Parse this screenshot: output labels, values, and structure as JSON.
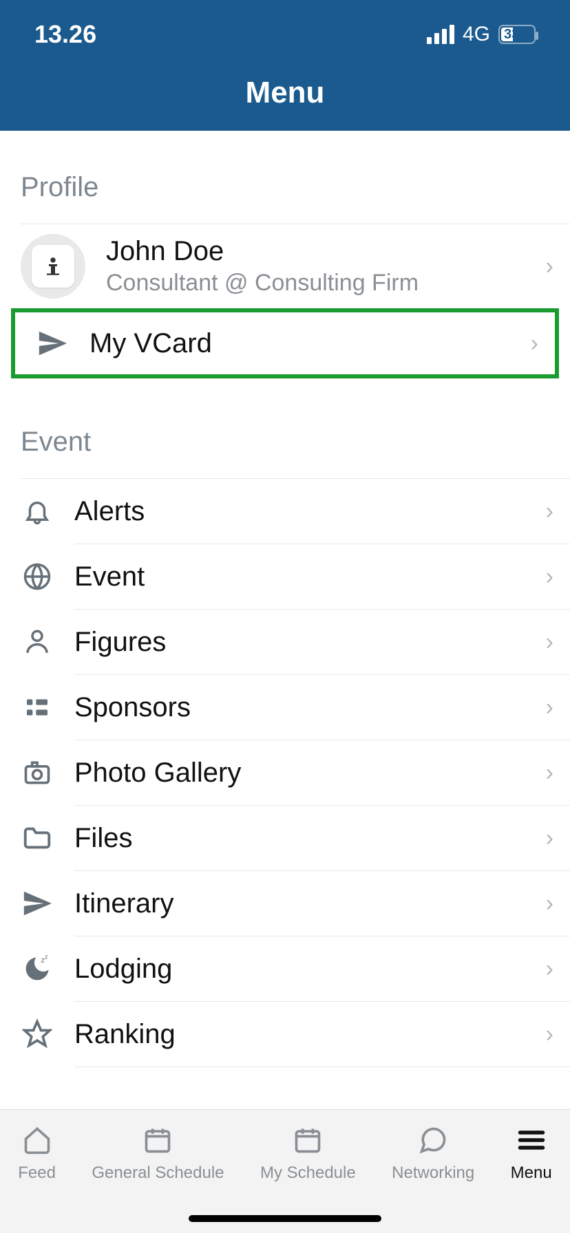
{
  "statusbar": {
    "time": "13.26",
    "network": "4G",
    "battery": "33"
  },
  "header": {
    "title": "Menu"
  },
  "sections": {
    "profile_label": "Profile",
    "event_label": "Event"
  },
  "profile": {
    "name": "John Doe",
    "subtitle": "Consultant @ Consulting Firm",
    "vcard_label": "My VCard"
  },
  "event_items": {
    "alerts": "Alerts",
    "event": "Event",
    "figures": "Figures",
    "sponsors": "Sponsors",
    "photo_gallery": "Photo Gallery",
    "files": "Files",
    "itinerary": "Itinerary",
    "lodging": "Lodging",
    "ranking": "Ranking"
  },
  "tabs": {
    "feed": "Feed",
    "general_schedule": "General Schedule",
    "my_schedule": "My Schedule",
    "networking": "Networking",
    "menu": "Menu"
  }
}
